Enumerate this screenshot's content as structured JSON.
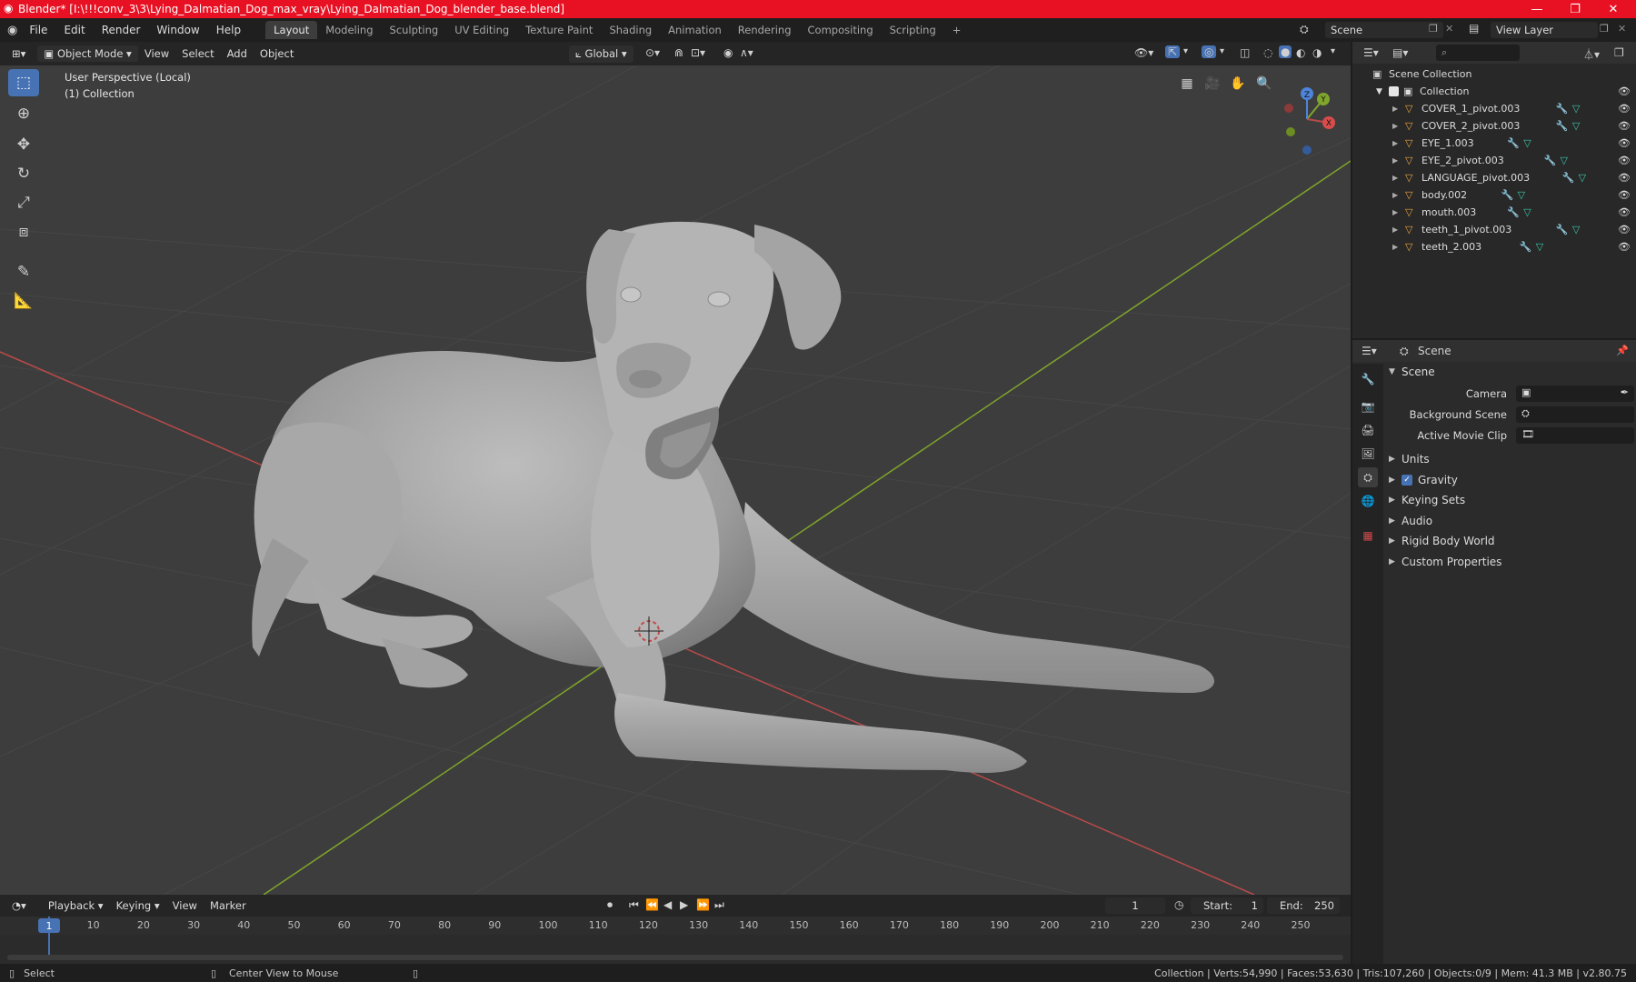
{
  "window": {
    "title": "Blender* [I:\\!!!conv_3\\3\\Lying_Dalmatian_Dog_max_vray\\Lying_Dalmatian_Dog_blender_base.blend]"
  },
  "menu": [
    "File",
    "Edit",
    "Render",
    "Window",
    "Help"
  ],
  "workspaces": [
    "Layout",
    "Modeling",
    "Sculpting",
    "UV Editing",
    "Texture Paint",
    "Shading",
    "Animation",
    "Rendering",
    "Compositing",
    "Scripting"
  ],
  "active_workspace": "Layout",
  "scene_selector": "Scene",
  "view_layer": "View Layer",
  "viewport_header": {
    "mode": "Object Mode",
    "menus": [
      "View",
      "Select",
      "Add",
      "Object"
    ],
    "transform_orientation": "Global"
  },
  "viewport": {
    "perspective_label": "User Perspective (Local)",
    "collection_label": "(1) Collection",
    "gizmo_axes": {
      "x": "X",
      "y": "Y",
      "z": "Z"
    }
  },
  "outliner": {
    "root": "Scene Collection",
    "collection": "Collection",
    "objects": [
      "COVER_1_pivot.003",
      "COVER_2_pivot.003",
      "EYE_1.003",
      "EYE_2_pivot.003",
      "LANGUAGE_pivot.003",
      "body.002",
      "mouth.003",
      "teeth_1_pivot.003",
      "teeth_2.003"
    ]
  },
  "properties": {
    "context": "Scene",
    "panel_title": "Scene",
    "fields": {
      "camera": "Camera",
      "background_scene": "Background Scene",
      "active_movie_clip": "Active Movie Clip"
    },
    "subpanels": [
      "Units",
      "Gravity",
      "Keying Sets",
      "Audio",
      "Rigid Body World",
      "Custom Properties"
    ],
    "gravity_enabled": true
  },
  "timeline": {
    "menus": [
      "Playback",
      "Keying",
      "View",
      "Marker"
    ],
    "current_frame": "1",
    "start_label": "Start:",
    "start": "1",
    "end_label": "End:",
    "end": "250",
    "ruler": [
      "1",
      "10",
      "20",
      "30",
      "40",
      "50",
      "60",
      "70",
      "80",
      "90",
      "100",
      "110",
      "120",
      "130",
      "140",
      "150",
      "160",
      "170",
      "180",
      "190",
      "200",
      "210",
      "220",
      "230",
      "240",
      "250"
    ]
  },
  "statusbar": {
    "select": "Select",
    "center_view": "Center View to Mouse",
    "stats": "Collection | Verts:54,990 | Faces:53,630 | Tris:107,260 | Objects:0/9 | Mem: 41.3 MB | v2.80.75"
  },
  "colors": {
    "titlebar": "#e81123",
    "accent": "#4772b3",
    "viewport_bg": "#3d3d3d",
    "x_axis": "#b84a4a",
    "y_axis": "#7fa52b",
    "object_icon": "#e8a33d",
    "modifier_icon": "#6aa9e0",
    "mesh_icon": "#3bc5a8"
  }
}
